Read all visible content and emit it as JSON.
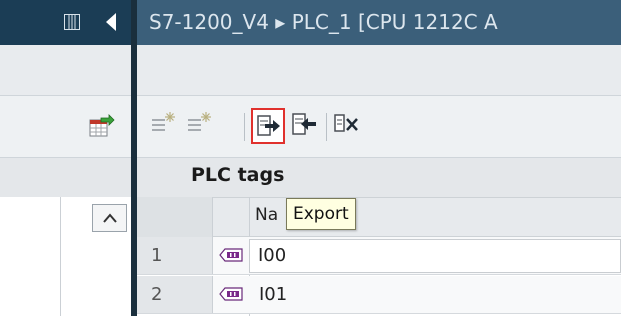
{
  "title_bar": {
    "breadcrumb": "S7-1200_V4  ▸  PLC_1 [CPU 1212C A"
  },
  "editor": {
    "title": "PLC tags"
  },
  "table": {
    "name_header": "Na",
    "rows": [
      {
        "num": "1",
        "name": "I00"
      },
      {
        "num": "2",
        "name": "I01"
      }
    ]
  },
  "tooltip": {
    "text": "Export"
  },
  "icons": {
    "left_panel": [
      "panel-toggle-icon",
      "collapse-left-icon",
      "table-export-icon",
      "collapse-up-icon"
    ],
    "toolbar": [
      "add-tag-icon",
      "insert-tag-icon",
      "export-icon",
      "import-icon",
      "delete-tag-icon"
    ]
  },
  "colors": {
    "highlight": "#e0312d",
    "title_bar": "#3b5f7a",
    "tooltip_bg": "#ffffe1"
  }
}
